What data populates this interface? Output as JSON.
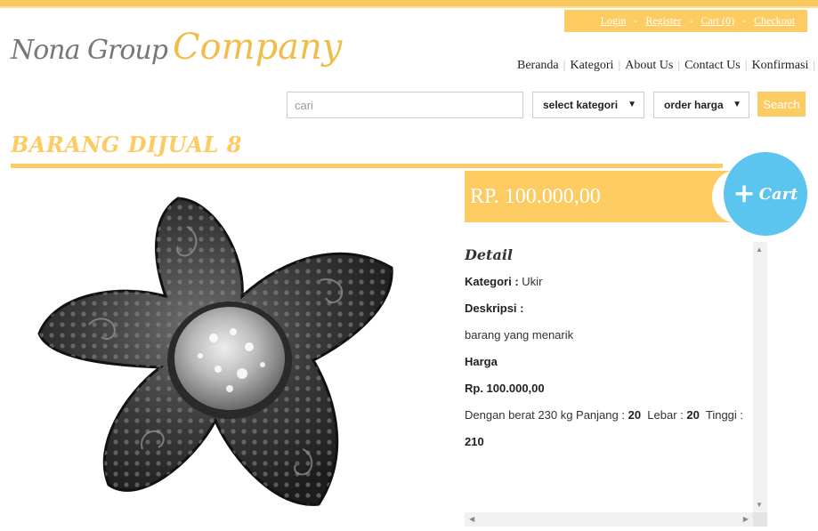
{
  "account": {
    "links": [
      "Login",
      "Register",
      "Cart (0)",
      "Checkout"
    ],
    "separator": "-"
  },
  "logo": {
    "part1": "Nona Group",
    "part2": "Company"
  },
  "nav": {
    "items": [
      "Beranda",
      "Kategori",
      "About Us",
      "Contact Us",
      "Konfirmasi"
    ],
    "divider": "|"
  },
  "search": {
    "placeholder": "cari",
    "value": "",
    "category_selected": "select kategori",
    "order_selected": "order harga",
    "button_label": "Search"
  },
  "page_title": "BARANG DIJUAL 8",
  "product": {
    "price_display": "RP. 100.000,00",
    "add_cart_plus": "+",
    "add_cart_label": "Cart",
    "detail": {
      "heading": "Detail",
      "kategori_label": "Kategori :",
      "kategori_value": "Ukir",
      "deskripsi_label": "Deskripsi :",
      "deskripsi_value": "barang yang menarik",
      "harga_label": "Harga",
      "harga_value": "Rp. 100.000,00",
      "dimension_prefix": "Dengan berat 230 kg Panjang :",
      "panjang": "20",
      "lebar_label": "Lebar :",
      "lebar": "20",
      "tinggi_label": "Tinggi :",
      "tinggi": "210"
    }
  },
  "colors": {
    "accent": "#fccb62",
    "cart_button": "#5bc4ef",
    "text": "#333333"
  },
  "icons": [
    "caret-down-icon",
    "plus-icon",
    "scroll-arrow-icon"
  ]
}
